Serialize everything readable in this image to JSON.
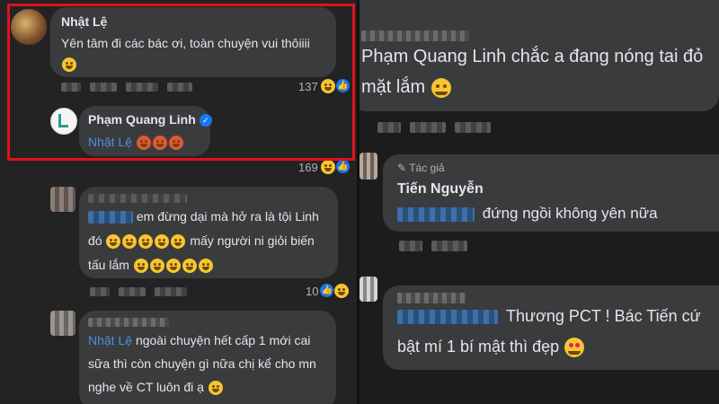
{
  "left": {
    "comment1": {
      "author": "Nhật Lệ",
      "text": "Yên tâm đi các bác ơi, toàn chuyện vui thôiiii",
      "reaction_count": "137"
    },
    "reply1": {
      "author": "Phạm Quang Linh",
      "mention": "Nhật Lệ",
      "reaction_count": "169"
    },
    "comment2": {
      "text_line1": "em đừng dại mà hở ra là tội Linh",
      "text_line2_prefix": "đó",
      "text_line2_suffix": "mấy người ni giỏi biến",
      "text_line3": "tấu lắm",
      "reaction_count": "10"
    },
    "comment3": {
      "mention": "Nhật Lệ",
      "text_line1": "ngoài chuyện hết cấp 1 mới cai",
      "text_line2": "sữa thì còn chuyện gì nữa chị kể cho mn",
      "text_line3": "nghe về CT luôn đi ạ"
    }
  },
  "right": {
    "post": {
      "text_line1": "Phạm Quang Linh chắc a đang nóng tai đỏ",
      "text_line2": "mặt lắm"
    },
    "reply_author_badge": "Tác giả",
    "reply": {
      "author": "Tiến Nguyễn",
      "text": "đứng ngồi không yên nữa"
    },
    "comment": {
      "text_line1": "Thương PCT ! Bác Tiến cứ",
      "text_line2": "bật mí 1 bí mật thì đẹp"
    }
  },
  "colors": {
    "highlight": "#e0121b",
    "mention": "#4a90e2",
    "verified": "#1877f2"
  }
}
